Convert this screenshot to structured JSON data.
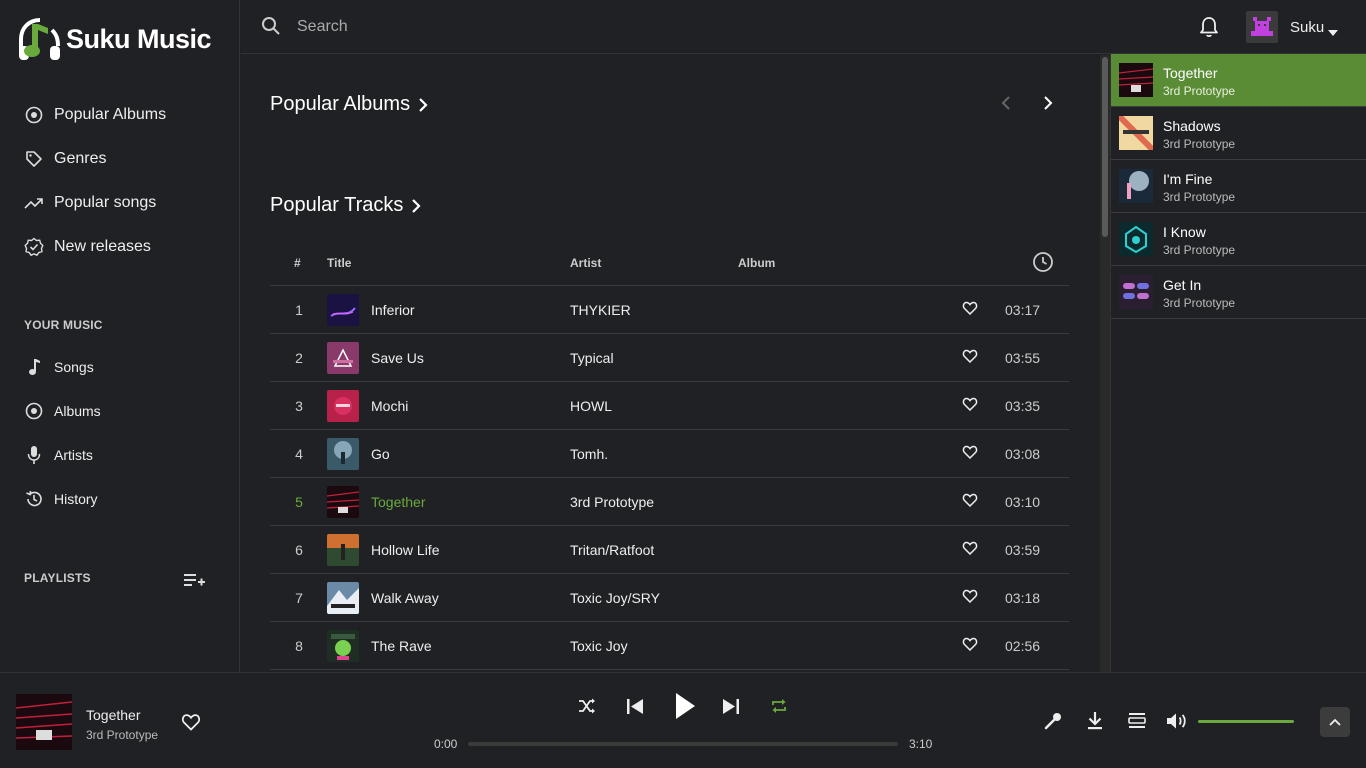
{
  "brand": {
    "name": "Suku Music",
    "accent": "#6aaa3c"
  },
  "sidebar": {
    "main_items": [
      {
        "label": "Popular Albums",
        "icon": "album-icon"
      },
      {
        "label": "Genres",
        "icon": "tag-icon"
      },
      {
        "label": "Popular songs",
        "icon": "trending-icon"
      },
      {
        "label": "New releases",
        "icon": "new-badge-icon"
      }
    ],
    "your_music_title": "YOUR MUSIC",
    "your_music_items": [
      {
        "label": "Songs",
        "icon": "music-note-icon"
      },
      {
        "label": "Albums",
        "icon": "album-icon"
      },
      {
        "label": "Artists",
        "icon": "microphone-icon"
      },
      {
        "label": "History",
        "icon": "history-icon"
      }
    ],
    "playlists_title": "PLAYLISTS"
  },
  "header": {
    "search_placeholder": "Search",
    "username": "Suku"
  },
  "main": {
    "albums_heading": "Popular Albums",
    "tracks_heading": "Popular Tracks",
    "columns": {
      "num": "#",
      "title": "Title",
      "artist": "Artist",
      "album": "Album"
    },
    "tracks": [
      {
        "num": "1",
        "title": "Inferior",
        "artist": "THYKIER",
        "duration": "03:17"
      },
      {
        "num": "2",
        "title": "Save Us",
        "artist": "Typical",
        "duration": "03:55"
      },
      {
        "num": "3",
        "title": "Mochi",
        "artist": "HOWL",
        "duration": "03:35"
      },
      {
        "num": "4",
        "title": "Go",
        "artist": "Tomh.",
        "duration": "03:08"
      },
      {
        "num": "5",
        "title": "Together",
        "artist": "3rd Prototype",
        "duration": "03:10"
      },
      {
        "num": "6",
        "title": "Hollow Life",
        "artist": "Tritan/Ratfoot",
        "duration": "03:59"
      },
      {
        "num": "7",
        "title": "Walk Away",
        "artist": "Toxic Joy/SRY",
        "duration": "03:18"
      },
      {
        "num": "8",
        "title": "The Rave",
        "artist": "Toxic Joy",
        "duration": "02:56"
      }
    ]
  },
  "queue": [
    {
      "title": "Together",
      "artist": "3rd Prototype"
    },
    {
      "title": "Shadows",
      "artist": "3rd Prototype"
    },
    {
      "title": "I'm Fine",
      "artist": "3rd Prototype"
    },
    {
      "title": "I Know",
      "artist": "3rd Prototype"
    },
    {
      "title": "Get In",
      "artist": "3rd Prototype"
    }
  ],
  "player": {
    "title": "Together",
    "artist": "3rd Prototype",
    "current_time": "0:00",
    "total_time": "3:10",
    "progress": 0,
    "volume": 1.0
  }
}
